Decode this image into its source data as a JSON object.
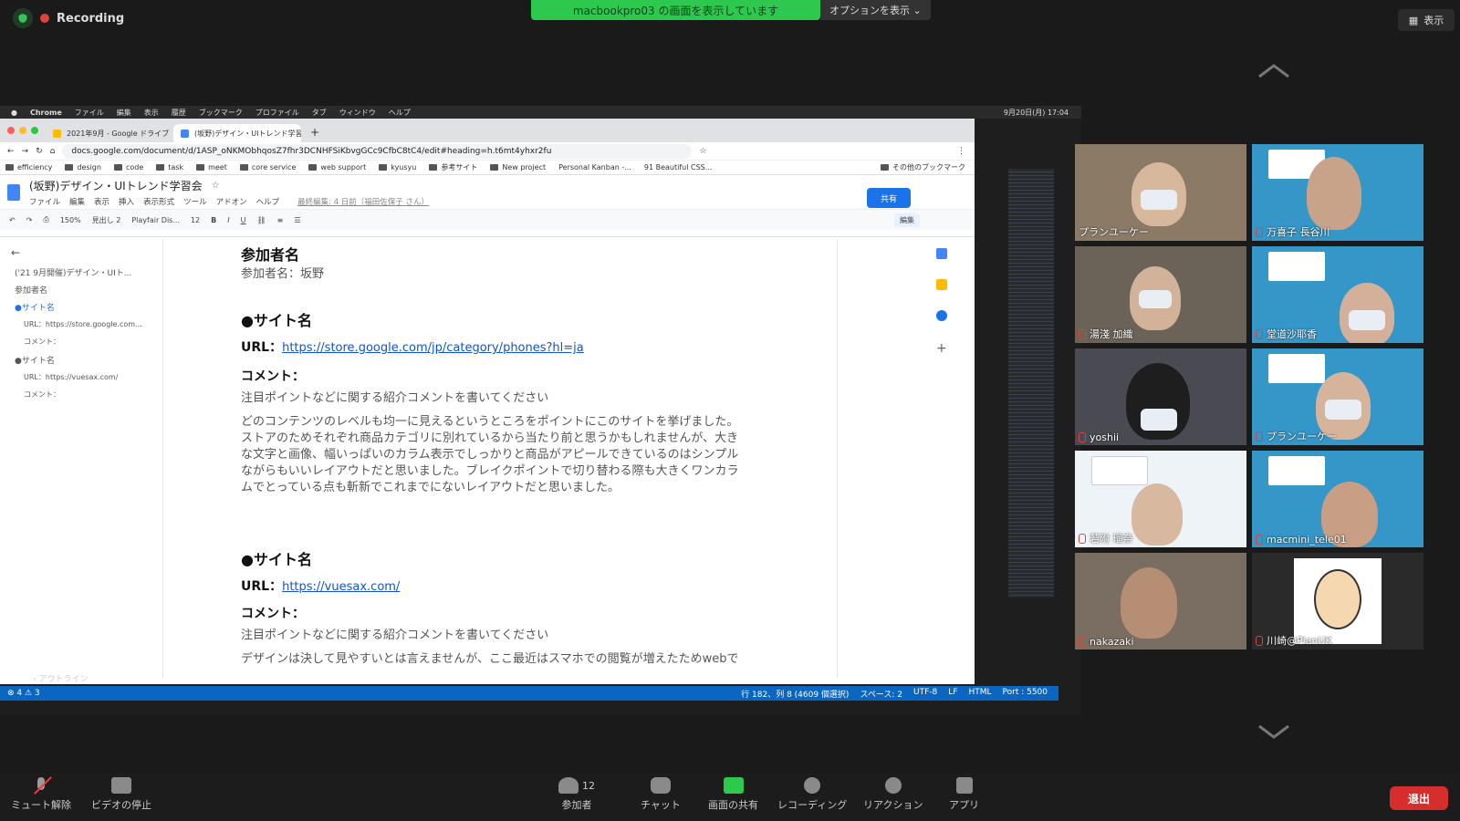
{
  "zoom_top": {
    "recording_label": "Recording",
    "share_banner": "macbookpro03 の画面を表示しています",
    "options_label": "オプションを表示",
    "view_label": "表示"
  },
  "mac_menubar": {
    "items": [
      "Chrome",
      "ファイル",
      "編集",
      "表示",
      "履歴",
      "ブックマーク",
      "プロファイル",
      "タブ",
      "ウィンドウ",
      "ヘルプ"
    ],
    "clock": "9月20日(月) 17:04"
  },
  "chrome": {
    "tabs": [
      {
        "label": "2021年9月 - Google ドライブ"
      },
      {
        "label": "(坂野)デザイン・UIトレンド学習会"
      }
    ],
    "url": "docs.google.com/document/d/1ASP_oNKMObhqosZ7fhr3DCNHFSiKbvgGCc9CfbC8tC4/edit#heading=h.t6mt4yhxr2fu",
    "bookmarks": [
      "efficiency",
      "design",
      "code",
      "task",
      "meet",
      "core service",
      "web support",
      "kyusyu",
      "参考サイト",
      "New project",
      "Personal Kanban -...",
      "91 Beautiful CSS..."
    ],
    "other_bookmarks": "その他のブックマーク"
  },
  "doc": {
    "title": "(坂野)デザイン・UIトレンド学習会",
    "menu": [
      "ファイル",
      "編集",
      "表示",
      "挿入",
      "表示形式",
      "ツール",
      "アドオン",
      "ヘルプ"
    ],
    "last_edit": "最終編集: 4 日前（福田佐保子 さん）",
    "share_label": "共有",
    "toolbar": {
      "zoom": "150%",
      "style": "見出し 2",
      "font": "Playfair Dis...",
      "size": "12",
      "mode": "編集"
    },
    "outline": [
      "('21 9月開催)デザイン・UIト...",
      "参加者名",
      "●サイト名",
      "URL：https://store.google.com...",
      "コメント：",
      "●サイト名",
      "URL：https://vuesax.com/",
      "コメント："
    ],
    "body": {
      "participant_heading": "参加者名",
      "participant_line": "参加者名：坂野",
      "site1_heading": "●サイト名",
      "url_label": "URL：",
      "site1_url": "https://store.google.com/jp/category/phones?hl=ja",
      "comment_label": "コメント：",
      "comment_hint": "注目ポイントなどに関する紹介コメントを書いてください",
      "site1_comment": [
        "どのコンテンツのレベルも均一に見えるというところをポイントにこのサイトを挙げました。",
        "ストアのためそれぞれ商品カテゴリに別れているから当たり前と思うかもしれませんが、大き",
        "な文字と画像、幅いっぱいのカラム表示でしっかりと商品がアピールできているのはシンプル",
        "ながらもいいレイアウトだと思いました。ブレイクポイントで切り替わる際も大きくワンカラ",
        "ムでとっている点も斬新でこれまでにないレイアウトだと思いました。"
      ],
      "site2_heading": "●サイト名",
      "site2_url": "https://vuesax.com/",
      "site2_comment": "デザインは決して見やすいとは言えませんが、ここ最近はスマホでの閲覧が増えたためwebで"
    }
  },
  "vscode": {
    "outline_label": "アウトライン",
    "problems": "⊗ 4 ⚠ 3",
    "status_right": [
      "行 182、列 8 (4609 個選択)",
      "スペース: 2",
      "UTF-8",
      "LF",
      "HTML",
      "Port : 5500"
    ]
  },
  "participants": [
    {
      "name": "プランユーケー",
      "muted": false
    },
    {
      "name": "万喜子 長谷川",
      "muted": true
    },
    {
      "name": "湯淺 加織",
      "muted": true
    },
    {
      "name": "堂道沙耶香",
      "muted": true
    },
    {
      "name": "yoshii",
      "muted": true
    },
    {
      "name": "プランユーケー",
      "muted": true
    },
    {
      "name": "若附 瑠奈",
      "muted": true
    },
    {
      "name": "macmini_tele01",
      "muted": true
    },
    {
      "name": "nakazaki",
      "muted": true
    },
    {
      "name": "川崎@PlanUK",
      "muted": true
    }
  ],
  "bottom_bar": {
    "unmute": "ミュート解除",
    "video": "ビデオの停止",
    "participants": "参加者",
    "participant_count": "12",
    "chat": "チャット",
    "share": "画面の共有",
    "record": "レコーディング",
    "reaction": "リアクション",
    "apps": "アプリ",
    "leave": "退出"
  },
  "colors": {
    "share_green": "#2dc94f",
    "leave_red": "#d62d2d",
    "link_blue": "#1155cc",
    "vscode_blue": "#0b66c2"
  }
}
